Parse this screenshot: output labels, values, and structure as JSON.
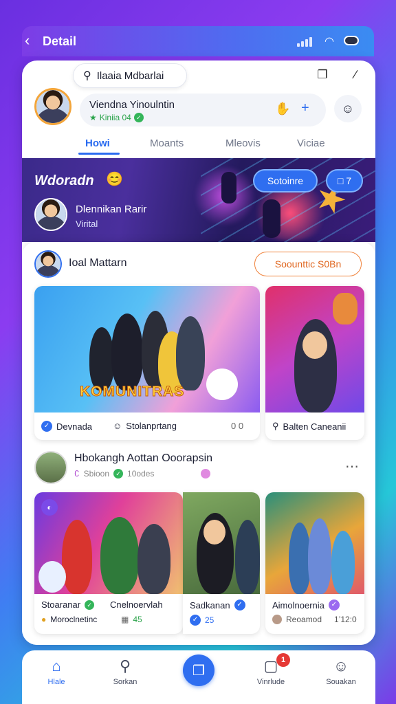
{
  "status": {
    "title": "Detail"
  },
  "header": {
    "search_label": "Ilaaia Mdbarlai"
  },
  "profile": {
    "name": "Viendna Yinoulntin",
    "subtitle": "Kiniia 04"
  },
  "tabs": [
    {
      "label": "Howi",
      "active": true
    },
    {
      "label": "Moants",
      "active": false
    },
    {
      "label": "Mleovis",
      "active": false
    },
    {
      "label": "Viciae",
      "active": false
    }
  ],
  "banner": {
    "title": "Wdoradn",
    "button1": "Sotoinre",
    "button2": "7",
    "name": "Dlennikan Rarir",
    "sub": "Virital"
  },
  "section1": {
    "title": "Ioal Mattarn",
    "button": "Soounttic S0Bn",
    "tiles": [
      {
        "overlay": "KOMUNITRAS",
        "meta1": "Devnada",
        "meta2": "Stolanprtang",
        "meta3": "0 0"
      },
      {
        "meta1": "Balten Caneanii"
      }
    ]
  },
  "section2": {
    "title": "Hbokangh Aottan Ooorapsin",
    "meta1": "Sbioon",
    "meta2": "10odes",
    "tiles": [
      {
        "label": "Stoaranar",
        "sub": "Moroclnetinc"
      },
      {
        "label": "Cnelnoervlah",
        "sub": "45"
      },
      {
        "label": "Sadkanan",
        "sub": "25"
      },
      {
        "label": "Aimolnoernia",
        "sub": "Reoamod",
        "extra": "1’12:0"
      }
    ]
  },
  "navbar": {
    "items": [
      {
        "label": "Hlale",
        "icon": "home-icon"
      },
      {
        "label": "Sorkan",
        "icon": "search-icon"
      },
      {
        "label": "Vinrlude",
        "icon": "bell-icon",
        "badge": "1"
      },
      {
        "label": "Souakan",
        "icon": "profile-icon"
      }
    ]
  },
  "colors": {
    "accent": "#2f6ef0",
    "orange": "#f0823a",
    "green": "#34b55a"
  }
}
